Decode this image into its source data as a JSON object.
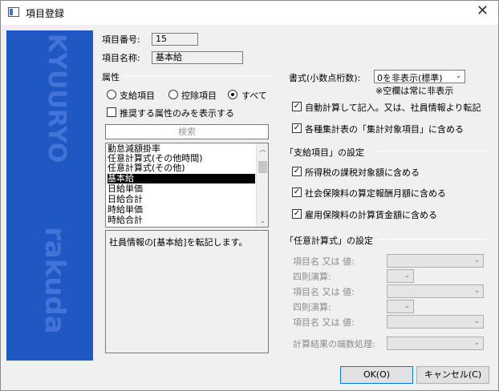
{
  "window": {
    "title": "項目登録",
    "close": "✕"
  },
  "sidebar": {
    "word_top": "KYUURYO",
    "word_bottom": "rakuda"
  },
  "item": {
    "number_label": "項目番号:",
    "number_value": "15",
    "name_label": "項目名称:",
    "name_value": "基本給"
  },
  "attributes": {
    "heading": "属性",
    "radio_payment": "支給項目",
    "radio_deduction": "控除項目",
    "radio_all": "すべて",
    "selected": "すべて",
    "recommended_only": "推奨する属性のみを表示する",
    "recommended_checked": false,
    "search_label": "検索",
    "list": [
      "勤怠減額掛率",
      "任意計算式(その他時間)",
      "任意計算式(その他)",
      "基本給",
      "日給単価",
      "日給合計",
      "時給単価",
      "時給合計"
    ],
    "selected_item": "基本給",
    "description": "社員情報の[基本給]を転記します。"
  },
  "format": {
    "label": "書式(小数点桁数):",
    "value": "0を非表示(標準)",
    "note": "※空欄は常に非表示",
    "auto_calc": "自動計算して記入。又は、社員情報より転記",
    "aggregate": "各種集計表の「集計対象項目」に含める"
  },
  "payment_settings": {
    "heading": "「支給項目」の設定",
    "income_tax": "所得税の課税対象額に含める",
    "social_insurance": "社会保険料の算定報酬月額に含める",
    "employment_insurance": "雇用保険料の計算賃金額に含める"
  },
  "formula_settings": {
    "heading": "「任意計算式」の設定",
    "name_or_value": "項目名 又は 値:",
    "arithmetic": "四則演算:",
    "rounding": "計算結果の端数処理:"
  },
  "buttons": {
    "ok": "OK(O)",
    "cancel": "キャンセル(C)"
  },
  "icons": {
    "check": "✓",
    "down": "⌄",
    "up": "︿"
  }
}
